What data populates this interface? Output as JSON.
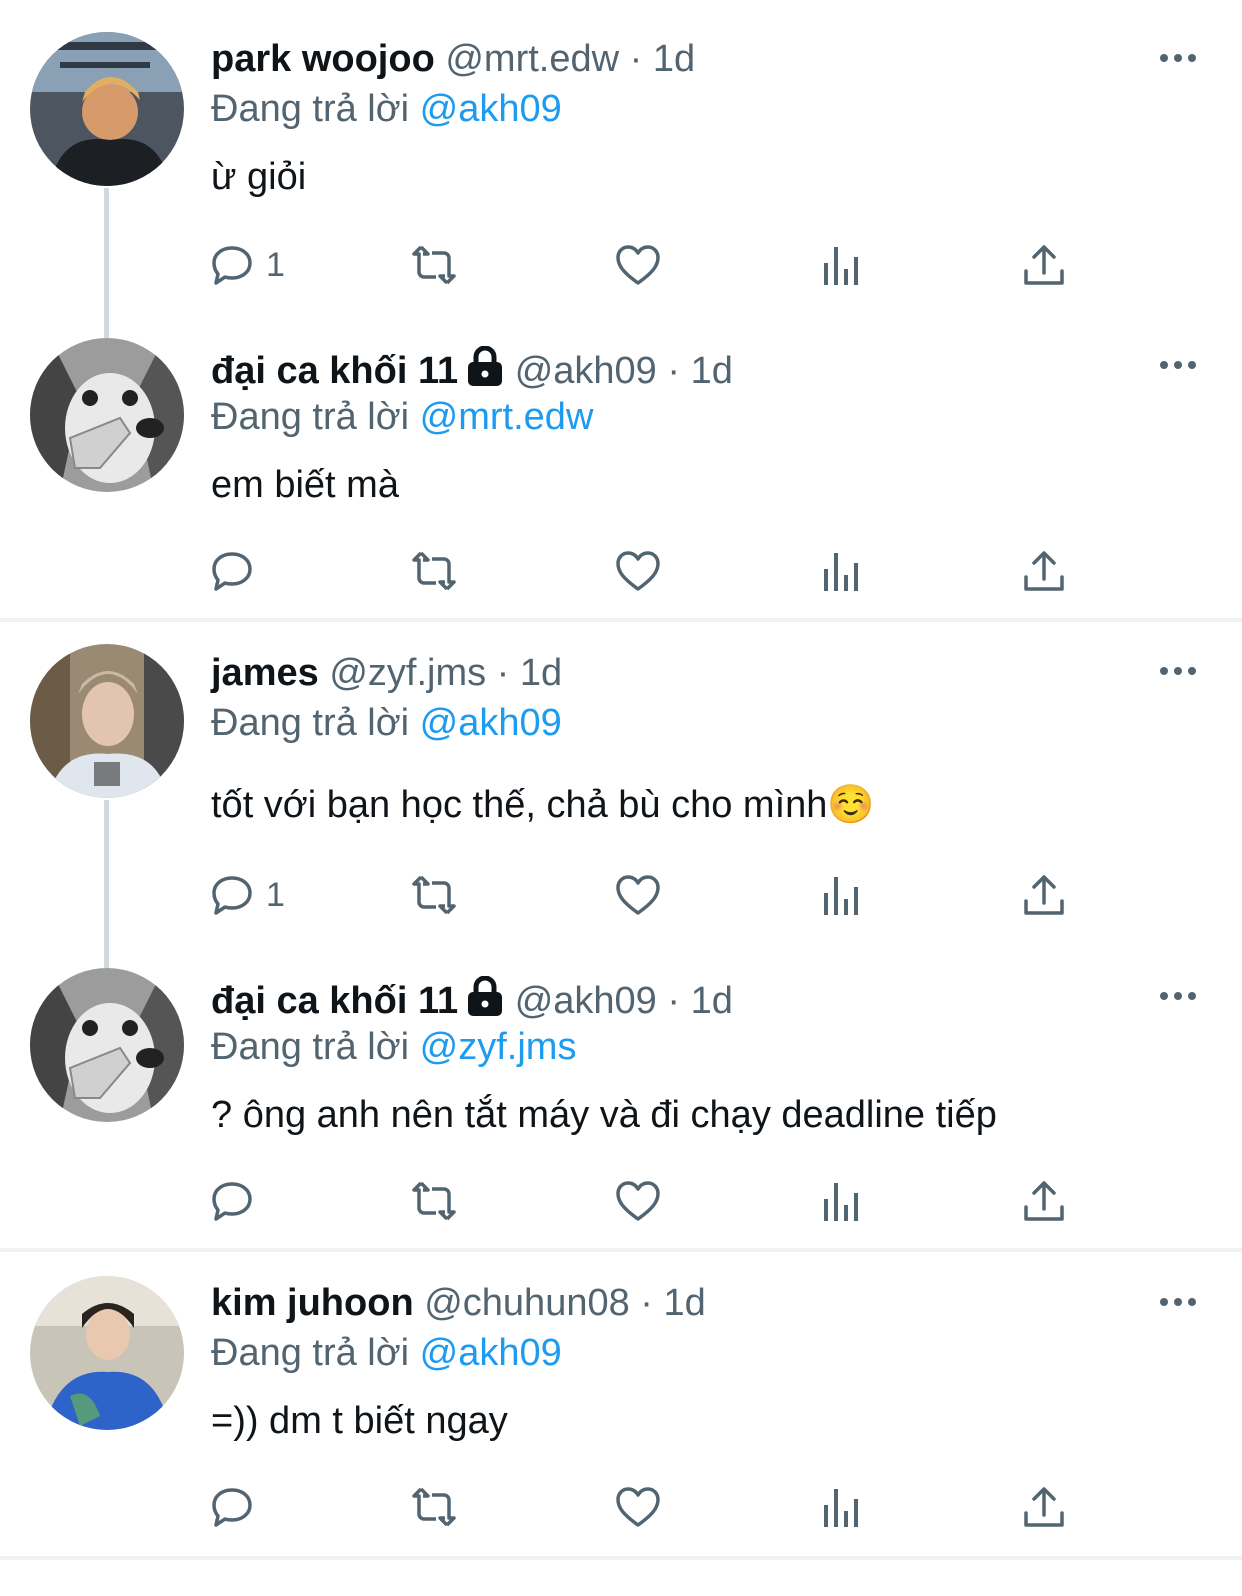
{
  "colors": {
    "text": "#0f1419",
    "muted": "#536471",
    "accent": "#1d9bf0",
    "thread_line": "#cfd9de",
    "separator": "#eff3f4"
  },
  "reply_prefix": "Đang trả lời",
  "tweets": [
    {
      "name": "park woojoo",
      "handle": "@mrt.edw",
      "dot": "·",
      "time": "1d",
      "reply_to": "@akh09",
      "text": "ừ giỏi",
      "reply_count": "1",
      "locked": false,
      "avatar": "photo-avatar"
    },
    {
      "name": "đại ca khối 11",
      "handle": "@akh09",
      "dot": "·",
      "time": "1d",
      "reply_to": "@mrt.edw",
      "text": "em biết mà",
      "reply_count": "",
      "locked": true,
      "avatar": "husky-avatar"
    },
    {
      "name": "james",
      "handle": "@zyf.jms",
      "dot": "·",
      "time": "1d",
      "reply_to": "@akh09",
      "text": "tốt với bạn học thế, chả bù cho mình☺️",
      "reply_count": "1",
      "locked": false,
      "avatar": "photo-avatar"
    },
    {
      "name": "đại ca khối 11",
      "handle": "@akh09",
      "dot": "·",
      "time": "1d",
      "reply_to": "@zyf.jms",
      "text": "? ông anh nên tắt máy và đi chạy deadline tiếp",
      "reply_count": "",
      "locked": true,
      "avatar": "husky-avatar"
    },
    {
      "name": "kim juhoon",
      "handle": "@chuhun08",
      "dot": "·",
      "time": "1d",
      "reply_to": "@akh09",
      "text": "=)) dm t biết ngay",
      "reply_count": "",
      "locked": false,
      "avatar": "photo-avatar"
    }
  ],
  "icons": [
    "more-icon",
    "reply-icon",
    "retweet-icon",
    "like-icon",
    "views-icon",
    "share-icon",
    "lock-icon"
  ]
}
